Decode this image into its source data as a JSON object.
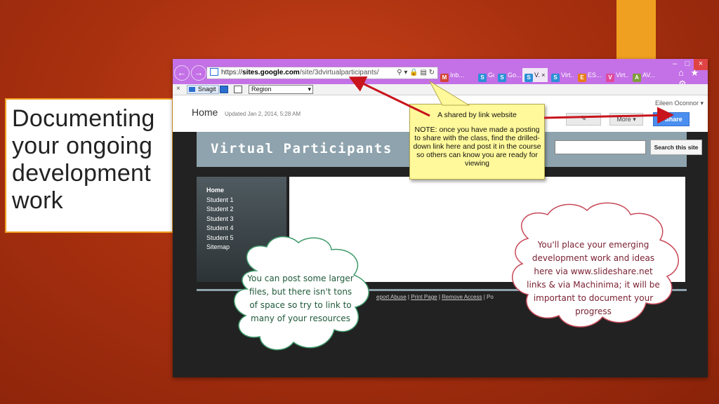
{
  "slide": {
    "title_lines": [
      "Documenting",
      "your ongoing",
      "development",
      "work"
    ],
    "colors": {
      "background": "#a8300f",
      "accent": "#f0a020",
      "window_frame": "#c470e6"
    }
  },
  "browser": {
    "window_controls": {
      "minimize": "–",
      "maximize": "□",
      "close": "×"
    },
    "nav_back": "←",
    "nav_forward": "→",
    "address": {
      "scheme": "https://",
      "host": "sites.google.com",
      "path": "/site/3dvirtualparticipants/",
      "tools": "⚲ ▾ 🔒 ▤ ↻"
    },
    "tabs": [
      {
        "label": "Inb...",
        "icon": "gmail-icon",
        "icon_char": "M",
        "color": "#d44638"
      },
      {
        "label": "Go...",
        "icon": "google-sites-icon",
        "icon_char": "S",
        "color": "#2b8fd8"
      },
      {
        "label": "Go...",
        "icon": "google-sites-icon",
        "icon_char": "S",
        "color": "#2b8fd8"
      },
      {
        "label": "V. ×",
        "icon": "google-sites-icon",
        "icon_char": "S",
        "color": "#2b8fd8",
        "active": true
      },
      {
        "label": "Virt...",
        "icon": "google-sites-icon",
        "icon_char": "S",
        "color": "#2b8fd8"
      },
      {
        "label": "ES...",
        "icon": "rss-icon",
        "icon_char": "E",
        "color": "#e77d1a"
      },
      {
        "label": "Virt...",
        "icon": "pink-site-icon",
        "icon_char": "V",
        "color": "#e04a9b"
      },
      {
        "label": "AV...",
        "icon": "av-icon",
        "icon_char": "A",
        "color": "#7f9c3a"
      }
    ],
    "ie_icons": "⌂ ★ ⚙",
    "toolbar": {
      "close": "×",
      "snagit": "Snagit",
      "region": "Region"
    }
  },
  "site": {
    "page_title": "Home",
    "updated": "Updated Jan 2, 2014, 5:28 AM",
    "user": "Eileen Oconnor ▾",
    "edit_icon": "✎",
    "more": "More ▾",
    "share": "Share",
    "site_name": "Virtual Participants",
    "search_button": "Search this site",
    "nav": [
      "Home",
      "Student 1",
      "Student 2",
      "Student 3",
      "Student 4",
      "Student 5",
      "Sitemap"
    ],
    "footer": {
      "items": [
        "eport Abuse",
        "Print Page",
        "Remove Access"
      ],
      "separator": " | ",
      "trailing": "Po"
    }
  },
  "callouts": {
    "note_title": "A shared by link website",
    "note_body": "NOTE:  once you have made a posting to share with the class, find the drilled-down link here and post it in the course so others can know you are ready for viewing",
    "cloud_left": "You can post some larger files, but there isn't tons of space so try to link to many of your resources",
    "cloud_right": "You'll place your emerging development work and ideas here via www.slideshare.net links & via Machinima; it will be important to document your progress"
  }
}
